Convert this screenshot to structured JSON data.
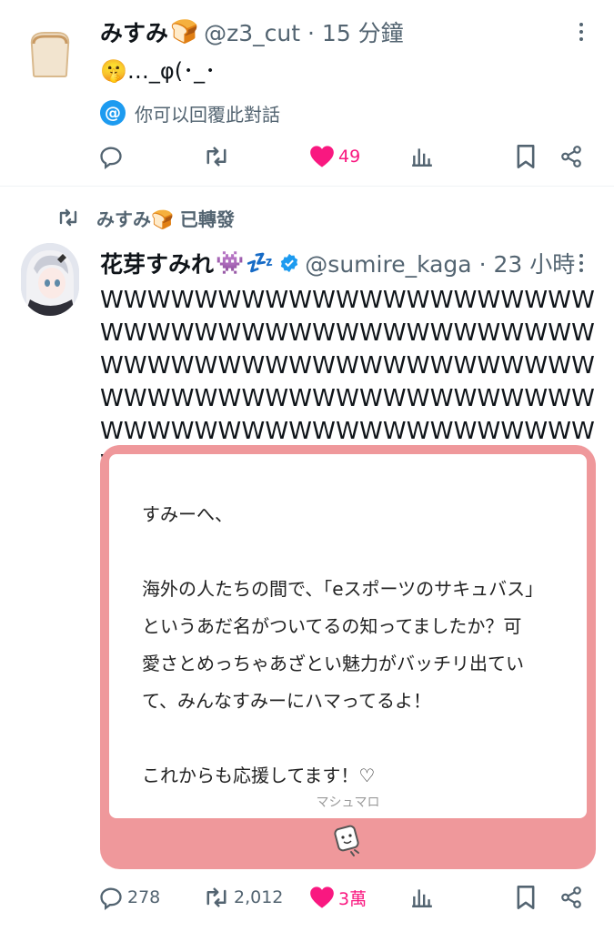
{
  "tweet1": {
    "name": "みすみ",
    "name_emoji": "🍞",
    "handle": "@z3_cut · 15 分鐘",
    "text": "🤫…_φ(･_･",
    "reply_note": "你可以回覆此對話",
    "at_symbol": "@",
    "like_count": "49",
    "icons": [
      "reply-icon",
      "retweet-icon",
      "heart-icon",
      "views-icon",
      "bookmark-icon",
      "share-icon"
    ]
  },
  "retweet_note": {
    "label": "みすみ🍞 已轉發"
  },
  "tweet2": {
    "name": "花芽すみれ",
    "name_emoji": "👾",
    "name_emoji2": "💤",
    "handle": "@sumire_kaga · 23 小時",
    "text": "WWWWWWWWWWWWWWWWWWWWWWWWWWWWWWWWWWWWWWWWWWWWWWWWWWWWWWWWWWWWWWWWWWWWWWWWWWWWWWWWWWWWWWWWWWWWWWWWWWWWWWWWWWWWWWWW",
    "card": {
      "message": "すみーへ、\n\n海外の人たちの間で、「eスポーツのサキュバス」\nというあだ名がついてるの知ってましたか？可\n愛さとめっちゃあざとい魅力がバッチリ出てい\nて、みんなすみーにハマってるよ！\n\nこれからも応援してます！♡",
      "brand": "マシュマロ",
      "colors": {
        "frame": "#ef989b"
      }
    },
    "reply_count": "278",
    "retweet_count": "2,012",
    "like_count": "3萬"
  },
  "colors": {
    "accent": "#1d9bf0",
    "like": "#f91880",
    "muted": "#536471"
  }
}
